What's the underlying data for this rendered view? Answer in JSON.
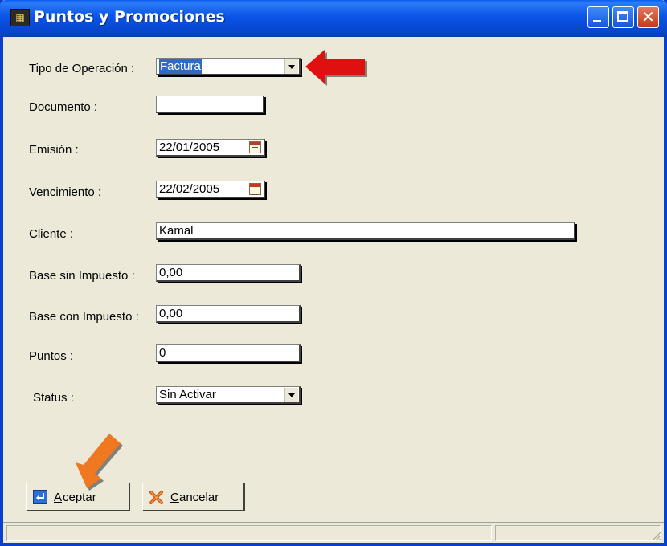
{
  "window": {
    "title": "Puntos y Promociones"
  },
  "form": {
    "tipo_label": "Tipo de Operación :",
    "tipo_value": "Factura",
    "documento_label": "Documento :",
    "documento_value": "",
    "emision_label": "Emisión :",
    "emision_value": "22/01/2005",
    "vencimiento_label": "Vencimiento :",
    "vencimiento_value": "22/02/2005",
    "cliente_label": "Cliente :",
    "cliente_value": "Kamal",
    "base_sin_label": "Base sin Impuesto :",
    "base_sin_value": "0,00",
    "base_con_label": "Base con Impuesto :",
    "base_con_value": "0,00",
    "puntos_label": "Puntos :",
    "puntos_value": "0",
    "status_label": "Status :",
    "status_value": "Sin Activar"
  },
  "buttons": {
    "aceptar_first": "A",
    "aceptar_rest": "ceptar",
    "cancelar_first": "C",
    "cancelar_rest": "ancelar"
  },
  "colors": {
    "titlebar": "#0A54E8",
    "window_bg": "#ECE9D8",
    "selection": "#316AC5",
    "red_arrow": "#E01010",
    "orange_arrow": "#F07820"
  },
  "icons": {
    "app": "app-icon",
    "calendar": "calendar-icon",
    "aceptar": "enter-icon",
    "cancelar": "x-icon"
  }
}
